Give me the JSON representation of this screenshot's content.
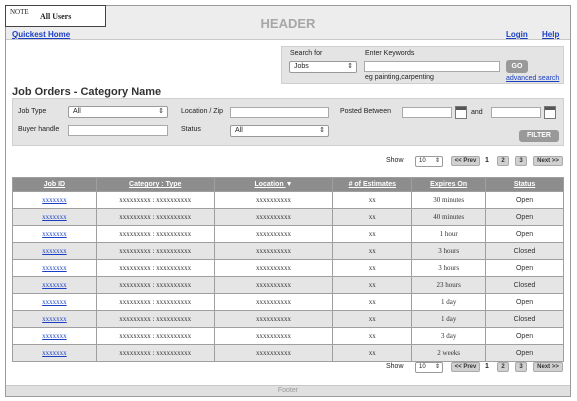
{
  "note": {
    "label": "NOTE",
    "text": "All Users"
  },
  "header": {
    "title": "HEADER"
  },
  "nav": {
    "home": "Quickest Home",
    "login": "Login",
    "help": "Help"
  },
  "search": {
    "search_for_label": "Search for",
    "search_for_value": "Jobs",
    "keywords_label": "Enter Keywords",
    "keywords_value": "",
    "hint": "eg painting,carpenting",
    "go_label": "GO",
    "advanced_label": "advanced search"
  },
  "page_title": "Job Orders - Category Name",
  "filters": {
    "job_type_label": "Job Type",
    "job_type_value": "All",
    "location_label": "Location / Zip",
    "posted_between_label": "Posted Between",
    "and_label": "and",
    "buyer_label": "Buyer handle",
    "status_label": "Status",
    "status_value": "All",
    "filter_button": "FILTER"
  },
  "pager": {
    "show_label": "Show",
    "page_size": "10",
    "prev_label": "<< Prev",
    "pages": [
      "1",
      "2",
      "3"
    ],
    "next_label": "Next >>"
  },
  "table": {
    "headers": [
      "Job ID",
      "Category : Type",
      "Location",
      "# of Estimates",
      "Expires On",
      "Status"
    ],
    "sort_indicator": "▼",
    "rows": [
      {
        "id": "xxxxxxx",
        "category": "xxxxxxxxx : xxxxxxxxxx",
        "location": "xxxxxxxxxx",
        "estimates": "xx",
        "expires": "30 minutes",
        "status": "Open"
      },
      {
        "id": "xxxxxxx",
        "category": "xxxxxxxxx : xxxxxxxxxx",
        "location": "xxxxxxxxxx",
        "estimates": "xx",
        "expires": "40 minutes",
        "status": "Open"
      },
      {
        "id": "xxxxxxx",
        "category": "xxxxxxxxx : xxxxxxxxxx",
        "location": "xxxxxxxxxx",
        "estimates": "xx",
        "expires": "1 hour",
        "status": "Open"
      },
      {
        "id": "xxxxxxx",
        "category": "xxxxxxxxx : xxxxxxxxxx",
        "location": "xxxxxxxxxx",
        "estimates": "xx",
        "expires": "3 hours",
        "status": "Closed"
      },
      {
        "id": "xxxxxxx",
        "category": "xxxxxxxxx : xxxxxxxxxx",
        "location": "xxxxxxxxxx",
        "estimates": "xx",
        "expires": "3 hours",
        "status": "Open"
      },
      {
        "id": "xxxxxxx",
        "category": "xxxxxxxxx : xxxxxxxxxx",
        "location": "xxxxxxxxxx",
        "estimates": "xx",
        "expires": "23 hours",
        "status": "Closed"
      },
      {
        "id": "xxxxxxx",
        "category": "xxxxxxxxx : xxxxxxxxxx",
        "location": "xxxxxxxxxx",
        "estimates": "xx",
        "expires": "1 day",
        "status": "Open"
      },
      {
        "id": "xxxxxxx",
        "category": "xxxxxxxxx : xxxxxxxxxx",
        "location": "xxxxxxxxxx",
        "estimates": "xx",
        "expires": "1 day",
        "status": "Closed"
      },
      {
        "id": "xxxxxxx",
        "category": "xxxxxxxxx : xxxxxxxxxx",
        "location": "xxxxxxxxxx",
        "estimates": "xx",
        "expires": "3 day",
        "status": "Open"
      },
      {
        "id": "xxxxxxx",
        "category": "xxxxxxxxx : xxxxxxxxxx",
        "location": "xxxxxxxxxx",
        "estimates": "xx",
        "expires": "2 weeks",
        "status": "Open"
      }
    ]
  },
  "footer": {
    "text": "Footer"
  }
}
